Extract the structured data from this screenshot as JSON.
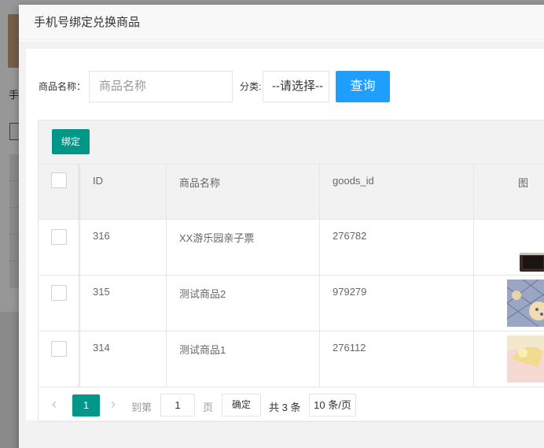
{
  "dialog": {
    "title": "手机号绑定兑换商品"
  },
  "background": {
    "char": "手"
  },
  "search": {
    "name_label": "商品名称：",
    "name_placeholder": "商品名称",
    "category_label": "分类:",
    "category_value": "--请选择--",
    "query_button": "查询"
  },
  "toolbar": {
    "bind_button": "绑定"
  },
  "table": {
    "headers": [
      "ID",
      "商品名称",
      "goods_id",
      "图"
    ],
    "rows": [
      {
        "id": "316",
        "name": "XX游乐园亲子票",
        "goods_id": "276782",
        "image": "toaster-oven-image"
      },
      {
        "id": "315",
        "name": "测试商品2",
        "goods_id": "979279",
        "image": "pastry-tray-image"
      },
      {
        "id": "314",
        "name": "测试商品1",
        "goods_id": "276112",
        "image": "cake-image"
      }
    ]
  },
  "pagination": {
    "prev": "‹",
    "current": "1",
    "next": "›",
    "goto_label": "到第",
    "goto_value": "1",
    "page_label": "页",
    "confirm": "确定",
    "count": "共 3 条",
    "page_size": "10 条/页"
  }
}
